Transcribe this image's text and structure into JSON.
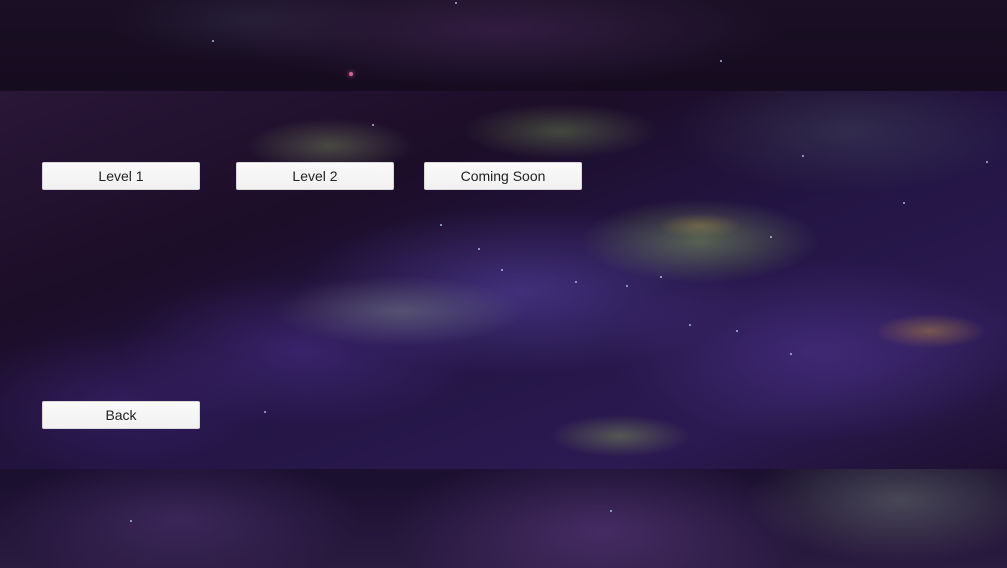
{
  "menu": {
    "levels": [
      {
        "label": "Level 1"
      },
      {
        "label": "Level 2"
      },
      {
        "label": "Coming Soon"
      }
    ],
    "back_label": "Back"
  },
  "colors": {
    "button_bg": "#f4f4f4",
    "button_text": "#222222",
    "background": "#1c0d28"
  }
}
